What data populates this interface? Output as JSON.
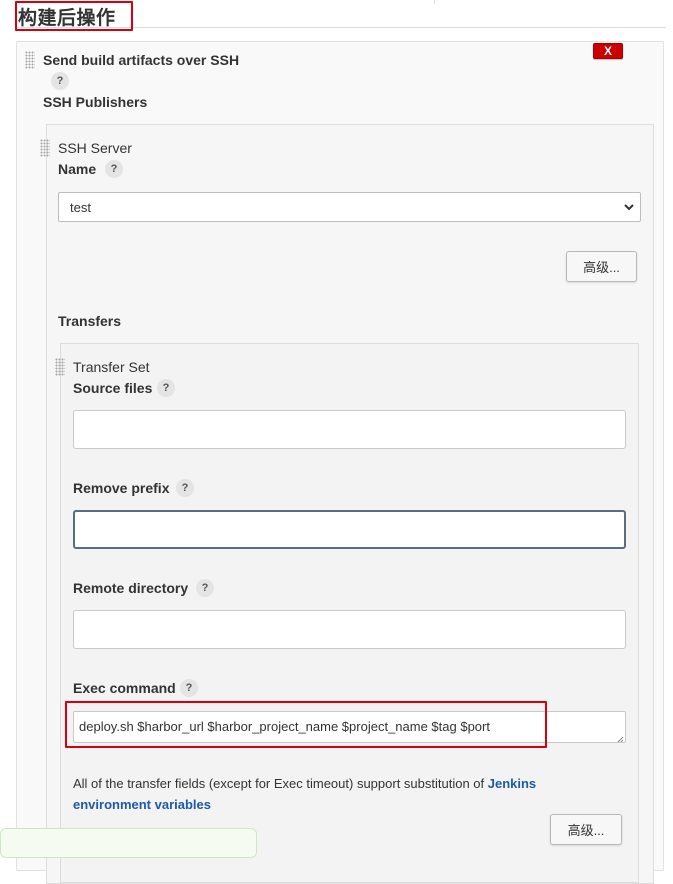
{
  "section": {
    "title": "构建后操作"
  },
  "publisher": {
    "title": "Send build artifacts over SSH",
    "delete_label": "X",
    "help": "?",
    "ssh_publishers_label": "SSH Publishers"
  },
  "ssh_server": {
    "heading": "SSH Server",
    "name_label": "Name",
    "name_help": "?",
    "name_selected": "test",
    "advanced_label": "高级..."
  },
  "transfers": {
    "label": "Transfers",
    "set_heading": "Transfer Set",
    "source_files_label": "Source files",
    "source_files_help": "?",
    "source_files_value": "",
    "remove_prefix_label": "Remove prefix",
    "remove_prefix_help": "?",
    "remove_prefix_value": "",
    "remote_directory_label": "Remote directory",
    "remote_directory_help": "?",
    "remote_directory_value": "",
    "exec_command_label": "Exec command",
    "exec_command_help": "?",
    "exec_command_value": "deploy.sh $harbor_url $harbor_project_name $project_name $tag $port",
    "info_text": "All of the transfer fields (except for Exec timeout) support substitution of ",
    "info_link": "Jenkins environment variables",
    "advanced_label": "高级..."
  },
  "colors": {
    "highlight_red": "#d7000f",
    "delete_red": "#cc0000",
    "link_blue": "#1d5aa8"
  }
}
